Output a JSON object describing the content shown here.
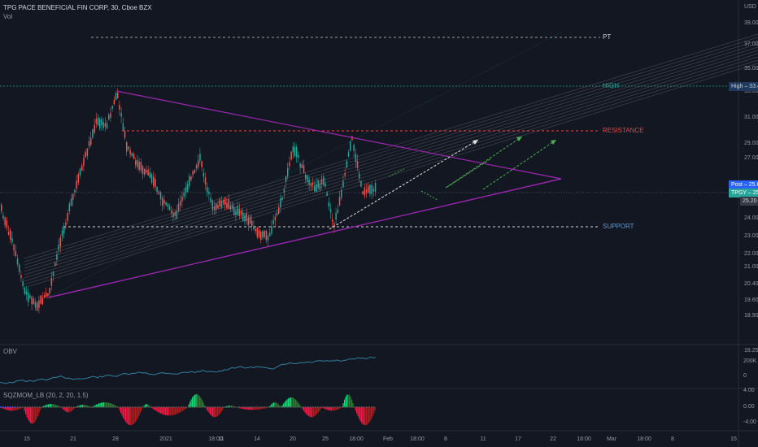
{
  "header": {
    "symbol_line": "TPG PACE BENEFICIAL FIN CORP, 30, Cboe BZX",
    "vol_label": "Vol"
  },
  "price_axis": {
    "currency": "USD",
    "ticks": [
      "39.00",
      "37.00",
      "35.00",
      "33.00",
      "31.00",
      "29.00",
      "27.00",
      "25.20",
      "24.00",
      "23.00",
      "22.00",
      "21.00",
      "20.40",
      "19.60",
      "18.90",
      "18.25"
    ],
    "tags": {
      "high": "High – 33.42",
      "post": "Post – 25.66",
      "last": "TPGY – 25.66",
      "value": "25.20"
    }
  },
  "annotations": {
    "pt": "PT",
    "high": "HIGH",
    "resistance": "RESISTANCE",
    "support": "SUPPORT"
  },
  "obv": {
    "label": "OBV",
    "ticks": [
      "200K",
      "0"
    ]
  },
  "sqzmom": {
    "label": "SQZMOM_LB (20, 2, 20, 1.5)",
    "ticks": [
      "4.00",
      "0.00",
      "-4.00"
    ]
  },
  "time_axis": {
    "labels": [
      "15",
      "21",
      "28",
      "2021",
      "18:00",
      "11",
      "14",
      "20",
      "25",
      "18:00",
      "Feb",
      "18:00",
      "8",
      "11",
      "17",
      "22",
      "18:00",
      "Mar",
      "18:00",
      "8",
      "15"
    ]
  },
  "colors": {
    "background": "#131722",
    "up": "#26a69a",
    "down": "#ef5350",
    "triangle": "#9c27b0",
    "resistance": "#e04848",
    "support_text": "#5b9bd5",
    "projection": "#4caf50"
  }
}
